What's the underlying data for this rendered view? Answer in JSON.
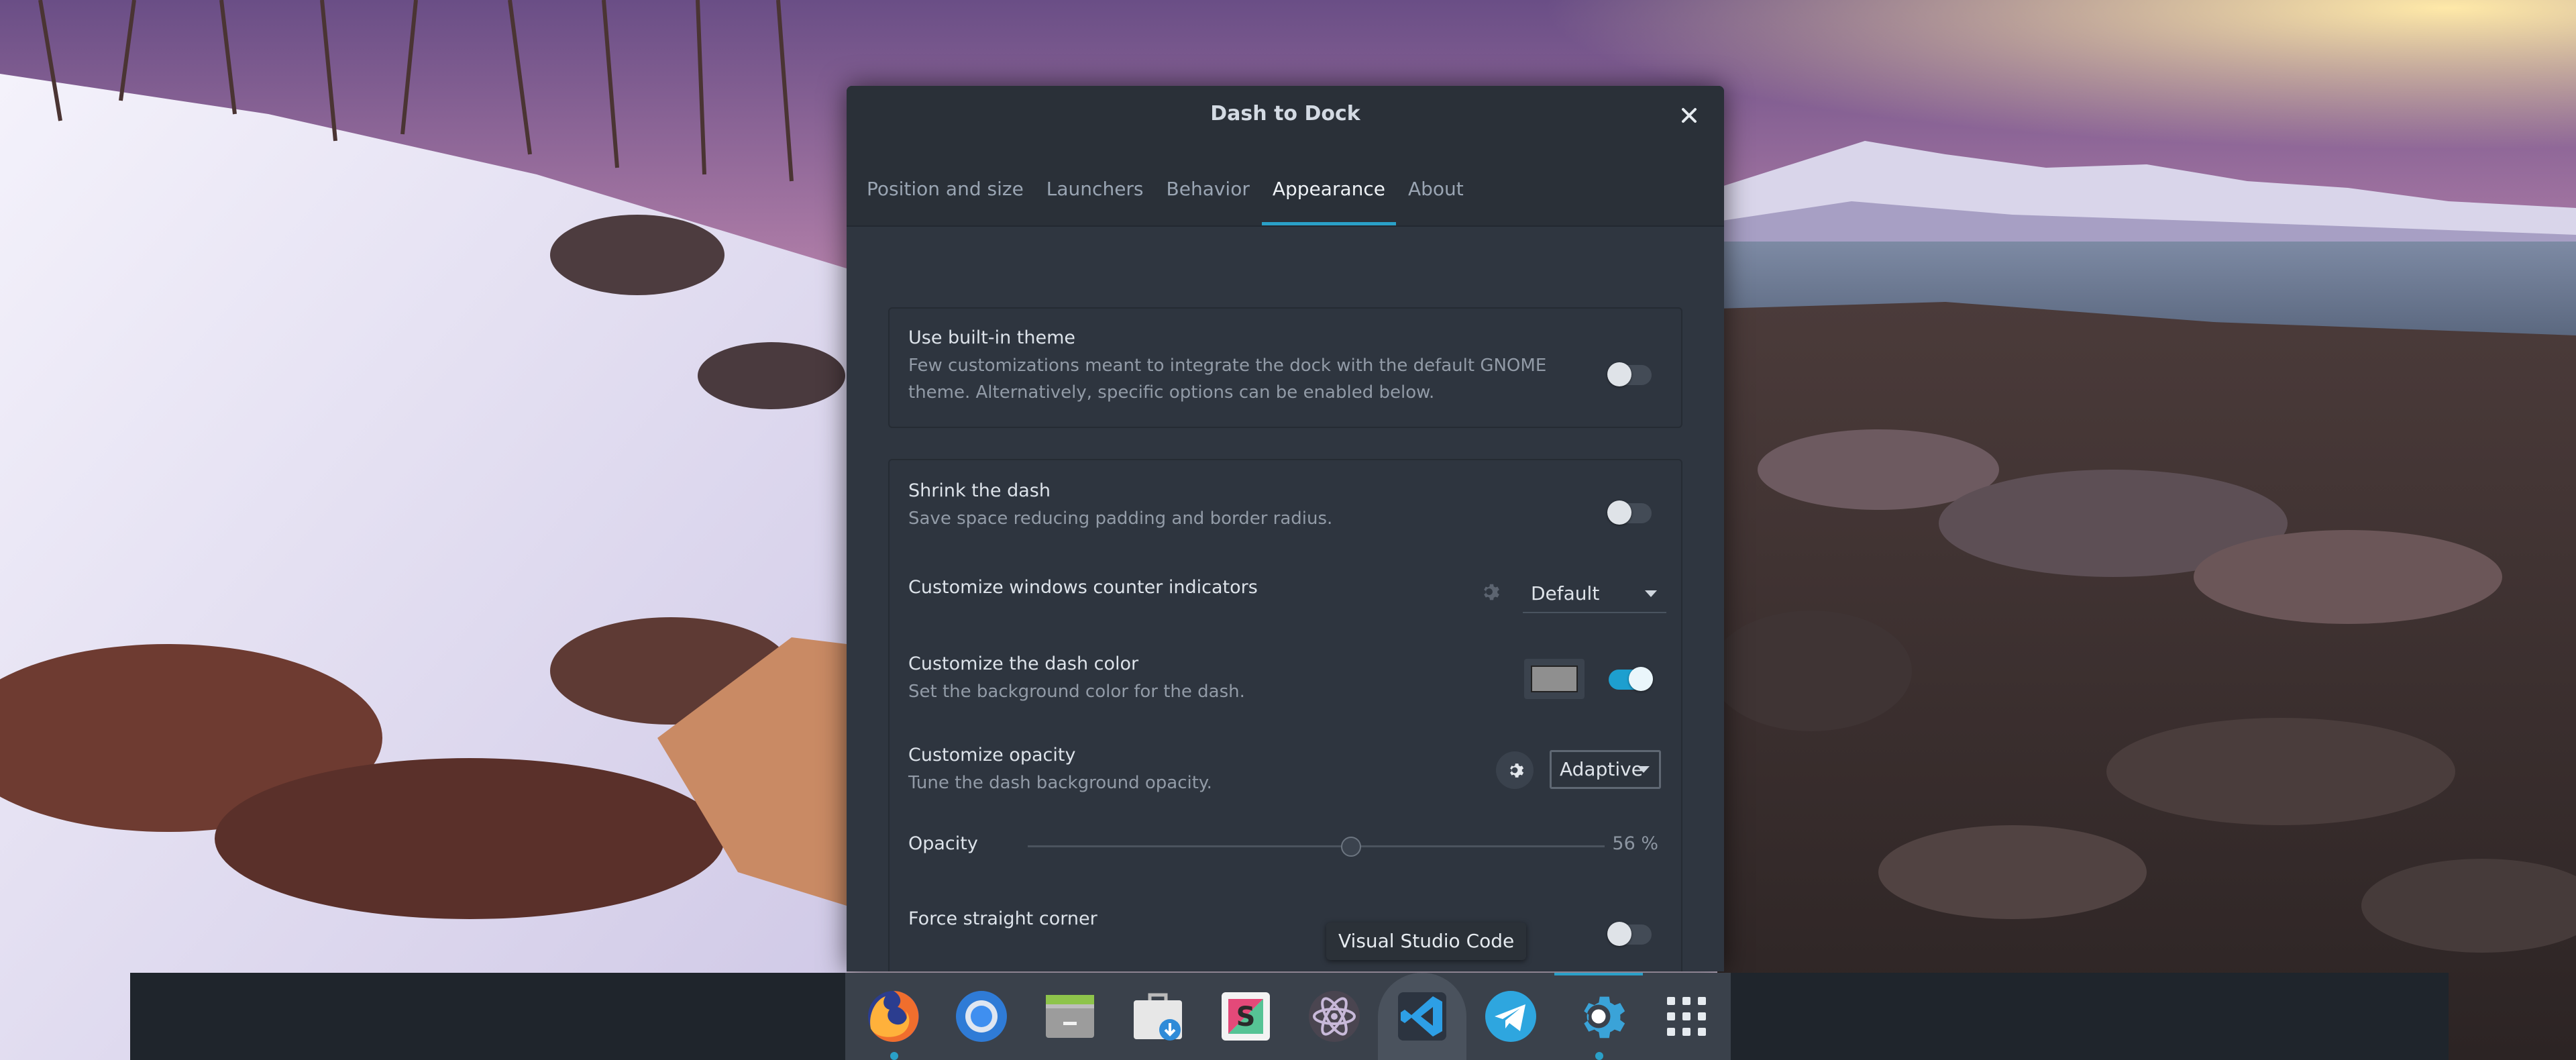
{
  "window": {
    "title": "Dash to Dock",
    "tabs": [
      {
        "label": "Position and size"
      },
      {
        "label": "Launchers"
      },
      {
        "label": "Behavior"
      },
      {
        "label": "Appearance"
      },
      {
        "label": "About"
      }
    ],
    "active_tab": "Appearance"
  },
  "settings": {
    "builtin_theme": {
      "title": "Use built-in theme",
      "line1": "Few customizations meant to integrate the dock with the default GNOME",
      "line2": "theme. Alternatively, specific options can be enabled below.",
      "enabled": false
    },
    "shrink_dash": {
      "title": "Shrink the dash",
      "subtitle": "Save space reducing padding and border radius.",
      "enabled": false
    },
    "counter_indicators": {
      "title": "Customize windows counter indicators",
      "value": "Default"
    },
    "dash_color": {
      "title": "Customize the dash color",
      "subtitle": "Set the background color for the dash.",
      "color": "#8f8f8f",
      "enabled": true
    },
    "opacity_mode": {
      "title": "Customize opacity",
      "subtitle": "Tune the dash background opacity.",
      "value": "Adaptive"
    },
    "opacity": {
      "label": "Opacity",
      "value_text": "56 %",
      "fraction": 0.56
    },
    "straight_corner": {
      "title": "Force straight corner",
      "enabled": false
    }
  },
  "tooltip": "Visual Studio Code",
  "dock": {
    "apps": [
      "firefox-icon",
      "chromium-icon",
      "file-manager-icon",
      "software-store-icon",
      "slack-icon",
      "atom-icon",
      "vscode-icon",
      "telegram-icon",
      "settings-icon",
      "app-grid-icon"
    ],
    "accent": "#2aa0c8"
  }
}
